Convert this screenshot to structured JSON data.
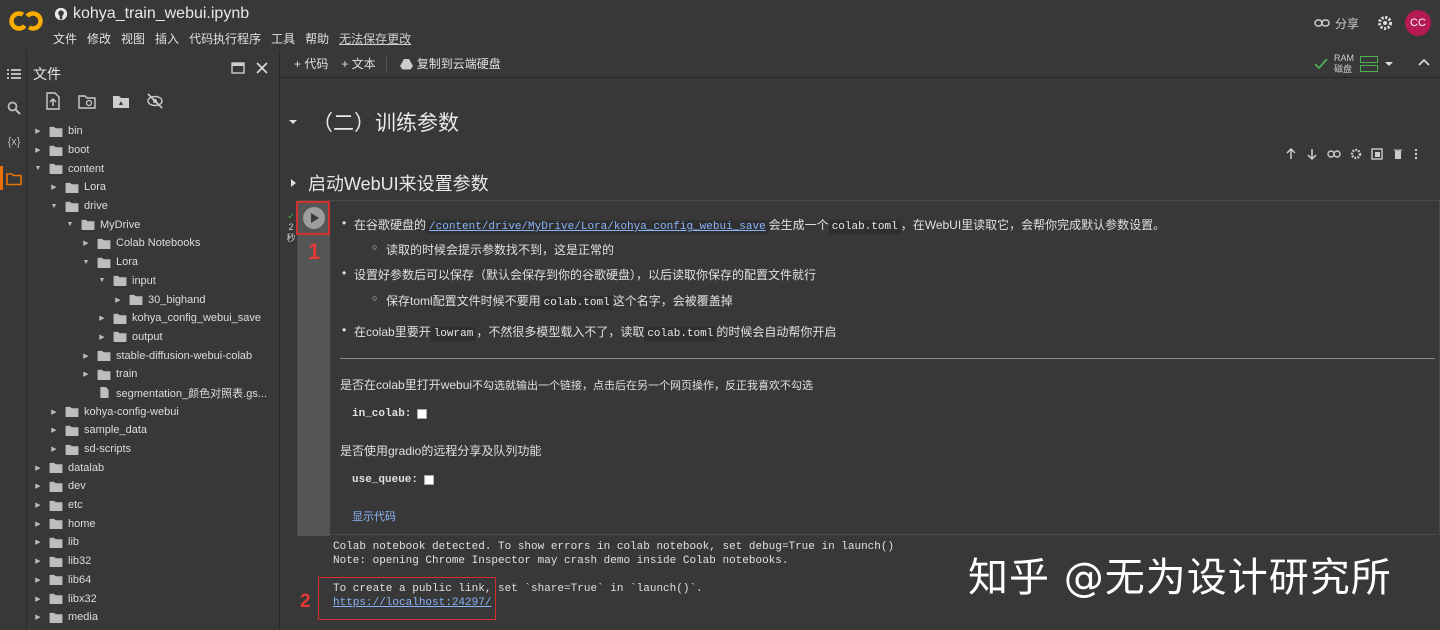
{
  "app": {
    "notebook_title": "kohya_train_webui.ipynb",
    "menu": [
      "文件",
      "修改",
      "视图",
      "插入",
      "代码执行程序",
      "工具",
      "帮助"
    ],
    "unsaved_text": "无法保存更改",
    "share_label": "分享",
    "avatar_initials": "CC"
  },
  "files_panel": {
    "title": "文件",
    "tree": [
      {
        "label": "bin",
        "level": 0,
        "expanded": false,
        "type": "folder"
      },
      {
        "label": "boot",
        "level": 0,
        "expanded": false,
        "type": "folder"
      },
      {
        "label": "content",
        "level": 0,
        "expanded": true,
        "type": "folder"
      },
      {
        "label": "Lora",
        "level": 1,
        "expanded": false,
        "type": "folder"
      },
      {
        "label": "drive",
        "level": 1,
        "expanded": true,
        "type": "folder"
      },
      {
        "label": "MyDrive",
        "level": 2,
        "expanded": true,
        "type": "folder"
      },
      {
        "label": "Colab Notebooks",
        "level": 3,
        "expanded": false,
        "type": "folder"
      },
      {
        "label": "Lora",
        "level": 3,
        "expanded": true,
        "type": "folder"
      },
      {
        "label": "input",
        "level": 4,
        "expanded": true,
        "type": "folder"
      },
      {
        "label": "30_bighand",
        "level": 5,
        "expanded": false,
        "type": "folder"
      },
      {
        "label": "kohya_config_webui_save",
        "level": 4,
        "expanded": false,
        "type": "folder"
      },
      {
        "label": "output",
        "level": 4,
        "expanded": false,
        "type": "folder"
      },
      {
        "label": "stable-diffusion-webui-colab",
        "level": 3,
        "expanded": false,
        "type": "folder"
      },
      {
        "label": "train",
        "level": 3,
        "expanded": false,
        "type": "folder"
      },
      {
        "label": "segmentation_颜色对照表.gs...",
        "level": 3,
        "expanded": null,
        "type": "file"
      },
      {
        "label": "kohya-config-webui",
        "level": 1,
        "expanded": false,
        "type": "folder"
      },
      {
        "label": "sample_data",
        "level": 1,
        "expanded": false,
        "type": "folder"
      },
      {
        "label": "sd-scripts",
        "level": 1,
        "expanded": false,
        "type": "folder"
      },
      {
        "label": "datalab",
        "level": 0,
        "expanded": false,
        "type": "folder"
      },
      {
        "label": "dev",
        "level": 0,
        "expanded": false,
        "type": "folder"
      },
      {
        "label": "etc",
        "level": 0,
        "expanded": false,
        "type": "folder"
      },
      {
        "label": "home",
        "level": 0,
        "expanded": false,
        "type": "folder"
      },
      {
        "label": "lib",
        "level": 0,
        "expanded": false,
        "type": "folder"
      },
      {
        "label": "lib32",
        "level": 0,
        "expanded": false,
        "type": "folder"
      },
      {
        "label": "lib64",
        "level": 0,
        "expanded": false,
        "type": "folder"
      },
      {
        "label": "libx32",
        "level": 0,
        "expanded": false,
        "type": "folder"
      },
      {
        "label": "media",
        "level": 0,
        "expanded": false,
        "type": "folder"
      }
    ]
  },
  "toolbar": {
    "code_label": "+ 代码",
    "text_label": "+ 文本",
    "copy_drive_label": "复制到云端硬盘",
    "ram_label": "RAM",
    "disk_label": "磁盘"
  },
  "notebook": {
    "section_heading": "（二）训练参数",
    "cell_heading": "启动WebUI来设置参数",
    "exec_time": "2\n秒",
    "annotation_1": "1",
    "annotation_2": "2",
    "md": {
      "b1_pre": "在谷歌硬盘的",
      "b1_link": "/content/drive/MyDrive/Lora/kohya_config_webui_save",
      "b1_mid": "会生成一个",
      "b1_code": "colab.toml",
      "b1_post": "，在WebUI里读取它，会帮你完成默认参数设置。",
      "b1_sub": "读取的时候会提示参数找不到，这是正常的",
      "b2": "设置好参数后可以保存（默认会保存到你的谷歌硬盘），以后读取你保存的配置文件就行",
      "b2_sub_pre": "保存toml配置文件时候不要用",
      "b2_sub_code": "colab.toml",
      "b2_sub_post": "这个名字，会被覆盖掉",
      "b3_pre": "在colab里要开",
      "b3_code1": "lowram",
      "b3_mid": "，不然很多模型载入不了，读取",
      "b3_code2": "colab.toml",
      "b3_post": "的时候会自动帮你开启"
    },
    "form": {
      "q1_main": "是否在colab里打开webui",
      "q1_small": "不勾选就输出一个链接，点击后在另一个网页操作，反正我喜欢不勾选",
      "param1": "in_colab:",
      "q2": "是否使用gradio的远程分享及队列功能",
      "param2": "use_queue:",
      "show_code": "显示代码"
    },
    "output": {
      "line1": "Colab notebook detected. To show errors in colab notebook, set debug=True in launch()",
      "line2": "Note: opening Chrome Inspector may crash demo inside Colab notebooks.",
      "line3": "To create a public link, set `share=True` in `launch()`.",
      "link": "https://localhost:24297/"
    }
  },
  "watermark": "知乎 @无为设计研究所",
  "colors": {
    "background": "#383838",
    "link": "#8ab4f8",
    "annotation_red": "#d32f2f",
    "avatar": "#b51a52",
    "colab_orange": "#f9ab00"
  }
}
